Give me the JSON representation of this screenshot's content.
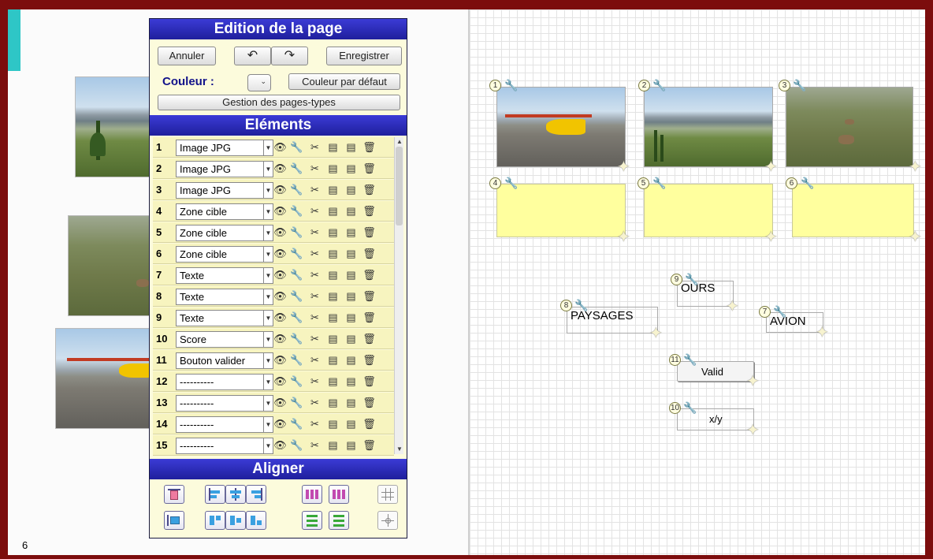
{
  "page_number": "6",
  "panel": {
    "title": "Edition de la page",
    "annuler": "Annuler",
    "enregistrer": "Enregistrer",
    "couleur_label": "Couleur :",
    "couleur_defaut": "Couleur par défaut",
    "gestion": "Gestion des pages-types",
    "elements_title": "Eléments",
    "aligner_title": "Aligner"
  },
  "elements": [
    {
      "n": "1",
      "type": "Image JPG"
    },
    {
      "n": "2",
      "type": "Image JPG"
    },
    {
      "n": "3",
      "type": "Image JPG"
    },
    {
      "n": "4",
      "type": "Zone cible"
    },
    {
      "n": "5",
      "type": "Zone cible"
    },
    {
      "n": "6",
      "type": "Zone cible"
    },
    {
      "n": "7",
      "type": "Texte"
    },
    {
      "n": "8",
      "type": "Texte"
    },
    {
      "n": "9",
      "type": "Texte"
    },
    {
      "n": "10",
      "type": "Score"
    },
    {
      "n": "11",
      "type": "Bouton valider"
    },
    {
      "n": "12",
      "type": "----------"
    },
    {
      "n": "13",
      "type": "----------"
    },
    {
      "n": "14",
      "type": "----------"
    },
    {
      "n": "15",
      "type": "----------"
    }
  ],
  "canvas": {
    "badges": [
      "1",
      "2",
      "3",
      "4",
      "5",
      "6",
      "9",
      "8",
      "7",
      "11",
      "10"
    ],
    "label_ours": "OURS",
    "label_paysages": "PAYSAGES",
    "label_avion": "AVION",
    "label_valid": "Valid",
    "label_score": "x/y"
  },
  "colors": {
    "book": "#7c0d0d",
    "panel_header": "#2a2ab8",
    "panel_bg": "#fcfbdc",
    "row_bg": "#f7f4bf",
    "target_zone": "#ffff9e",
    "bookmark": "#2ec6c6"
  },
  "icons": {
    "undo": "undo-icon",
    "redo": "redo-icon",
    "eye": "eye-icon",
    "wrench": "wrench-icon",
    "scissors": "scissors-icon",
    "copy": "copy-icon",
    "paste": "paste-icon",
    "trash": "trash-icon"
  }
}
